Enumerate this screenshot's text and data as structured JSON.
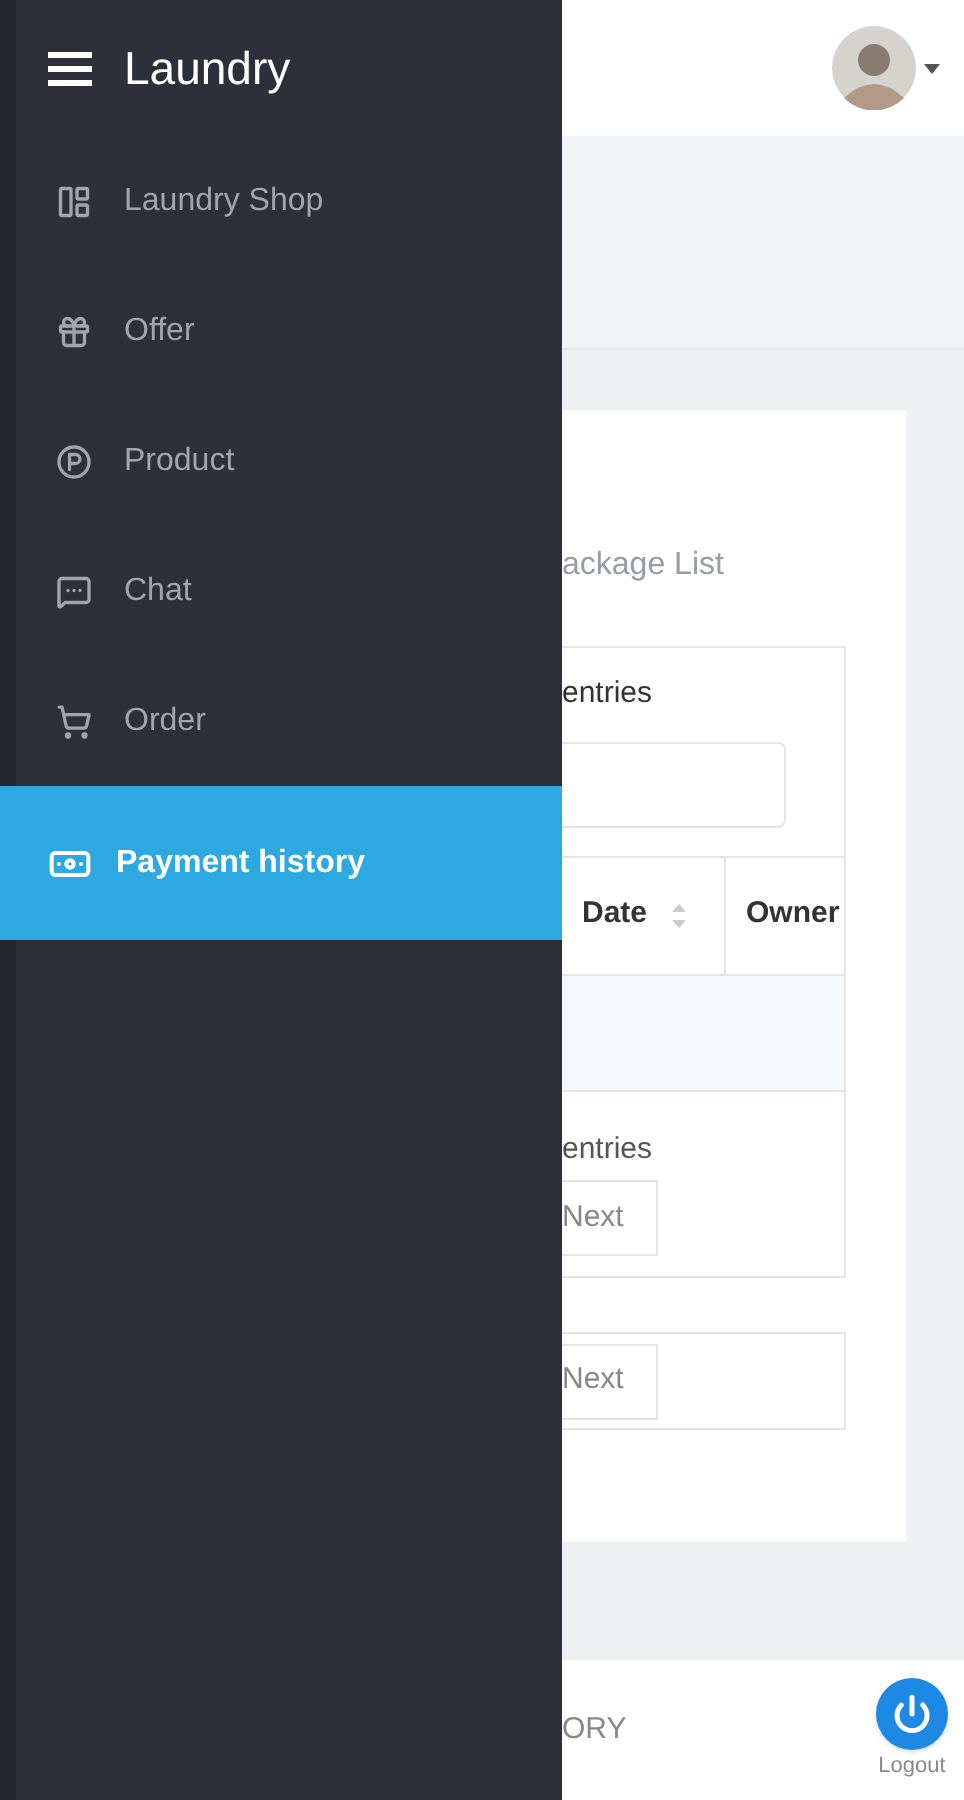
{
  "drawer": {
    "title": "Laundry",
    "items": [
      {
        "label": "Laundry Shop",
        "kind": "shop",
        "selected": false
      },
      {
        "label": "Offer",
        "kind": "gift",
        "selected": false
      },
      {
        "label": "Product",
        "kind": "product",
        "selected": false
      },
      {
        "label": "Chat",
        "kind": "chat",
        "selected": false
      },
      {
        "label": "Order",
        "kind": "cart",
        "selected": false
      },
      {
        "label": "Payment history",
        "kind": "money",
        "selected": true
      }
    ]
  },
  "page": {
    "card_title": "ackage List",
    "length_label": "entries",
    "table": {
      "columns": [
        {
          "label": "Date",
          "sortable": true
        },
        {
          "label": "Owner",
          "sortable": false
        }
      ]
    },
    "info": "entries",
    "pager_next": "Next",
    "pager2_next": "Next",
    "footer_label": "ORY",
    "logout": "Logout"
  }
}
